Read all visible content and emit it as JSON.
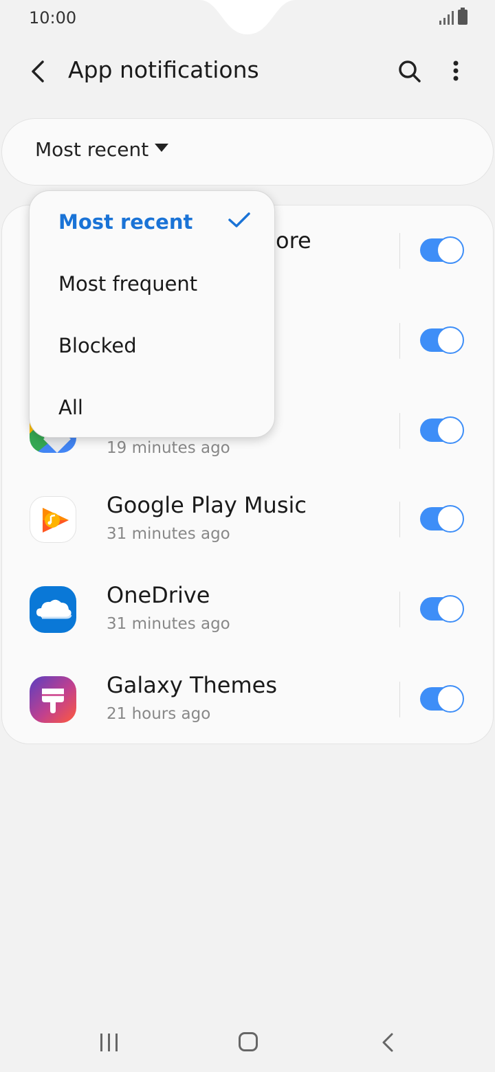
{
  "status": {
    "time": "10:00"
  },
  "header": {
    "title": "App notifications"
  },
  "filter": {
    "selected": "Most recent"
  },
  "dropdown": {
    "options": [
      "Most recent",
      "Most frequent",
      "Blocked",
      "All"
    ],
    "selected_index": 0
  },
  "apps": [
    {
      "name": "Galaxy Store",
      "visible_name": "ore",
      "time": "",
      "enabled": true
    },
    {
      "name": "",
      "time": "",
      "enabled": true
    },
    {
      "name": "Maps",
      "time": "19 minutes ago",
      "enabled": true
    },
    {
      "name": "Google Play Music",
      "time": "31 minutes ago",
      "enabled": true
    },
    {
      "name": "OneDrive",
      "time": "31 minutes ago",
      "enabled": true
    },
    {
      "name": "Galaxy Themes",
      "time": "21 hours ago",
      "enabled": true
    }
  ],
  "colors": {
    "accent": "#1a73d6",
    "toggle_on": "#3e8ef7"
  },
  "icons": [
    "back-arrow-icon",
    "search-icon",
    "more-vert-icon",
    "caret-down-icon",
    "check-icon",
    "nav-recent-icon",
    "nav-home-icon",
    "nav-back-icon"
  ]
}
